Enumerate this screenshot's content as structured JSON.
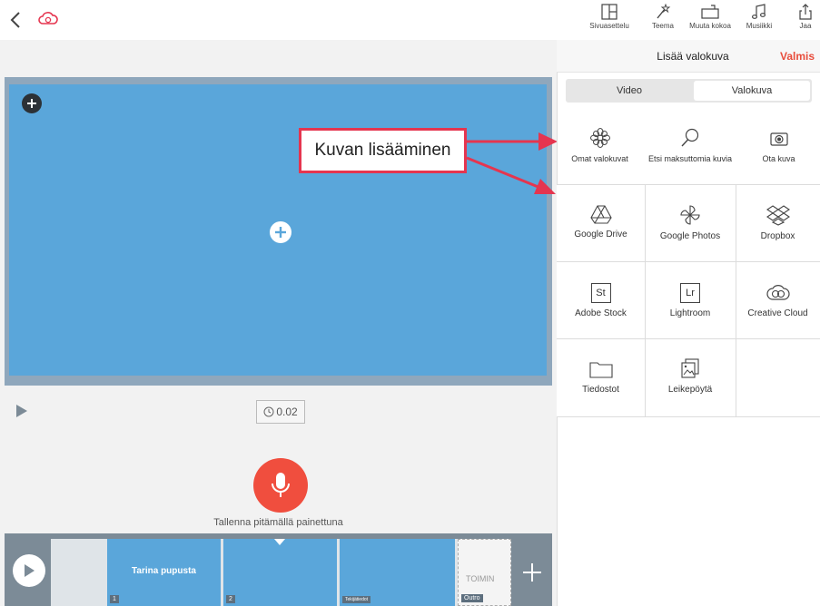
{
  "topbar": {
    "back_icon": "chevron-left-icon",
    "cloud_icon": "cloud-sync-icon",
    "accent": "#e5354f",
    "buttons": [
      {
        "label": "Sivuasettelu",
        "icon": "layout-icon"
      },
      {
        "label": "Teema",
        "icon": "wand-icon"
      },
      {
        "label": "Muuta kokoa",
        "icon": "resize-icon"
      },
      {
        "label": "Musiikki",
        "icon": "music-note-icon"
      },
      {
        "label": "Jaa",
        "icon": "share-icon"
      }
    ]
  },
  "editor": {
    "canvas_color": "#5aa6da",
    "annotation": "Kuvan lisääminen",
    "annotation_color": "#e5354f",
    "timer": "0.02",
    "record_hint": "Tallenna pitämällä painettuna",
    "mic_color": "#f04e3e"
  },
  "timeline": {
    "clips": [
      {
        "title": "Tarina pupusta",
        "number": "1"
      },
      {
        "title": "",
        "number": "2"
      },
      {
        "title": "",
        "number": "Tekijätiedot"
      },
      {
        "title": "TOIMIN",
        "number": "Outro"
      }
    ]
  },
  "panel": {
    "title": "Lisää valokuva",
    "done": "Valmis",
    "done_color": "#e84d3c",
    "tabs": [
      {
        "label": "Video",
        "selected": false
      },
      {
        "label": "Valokuva",
        "selected": true
      }
    ],
    "sources": [
      {
        "label": "Omat valokuvat",
        "icon": "flower-icon"
      },
      {
        "label": "Etsi maksuttomia kuvia",
        "icon": "search-icon"
      },
      {
        "label": "Ota kuva",
        "icon": "camera-icon"
      }
    ],
    "grid": [
      {
        "label": "Google Drive",
        "icon": "google-drive-icon"
      },
      {
        "label": "Google Photos",
        "icon": "pinwheel-icon"
      },
      {
        "label": "Dropbox",
        "icon": "dropbox-icon"
      },
      {
        "label": "Adobe Stock",
        "icon": "adobe-stock-icon",
        "glyph": "St"
      },
      {
        "label": "Lightroom",
        "icon": "lightroom-icon",
        "glyph": "Lr"
      },
      {
        "label": "Creative Cloud",
        "icon": "creative-cloud-icon"
      },
      {
        "label": "Tiedostot",
        "icon": "folder-icon"
      },
      {
        "label": "Leikepöytä",
        "icon": "clipboard-image-icon"
      }
    ]
  }
}
